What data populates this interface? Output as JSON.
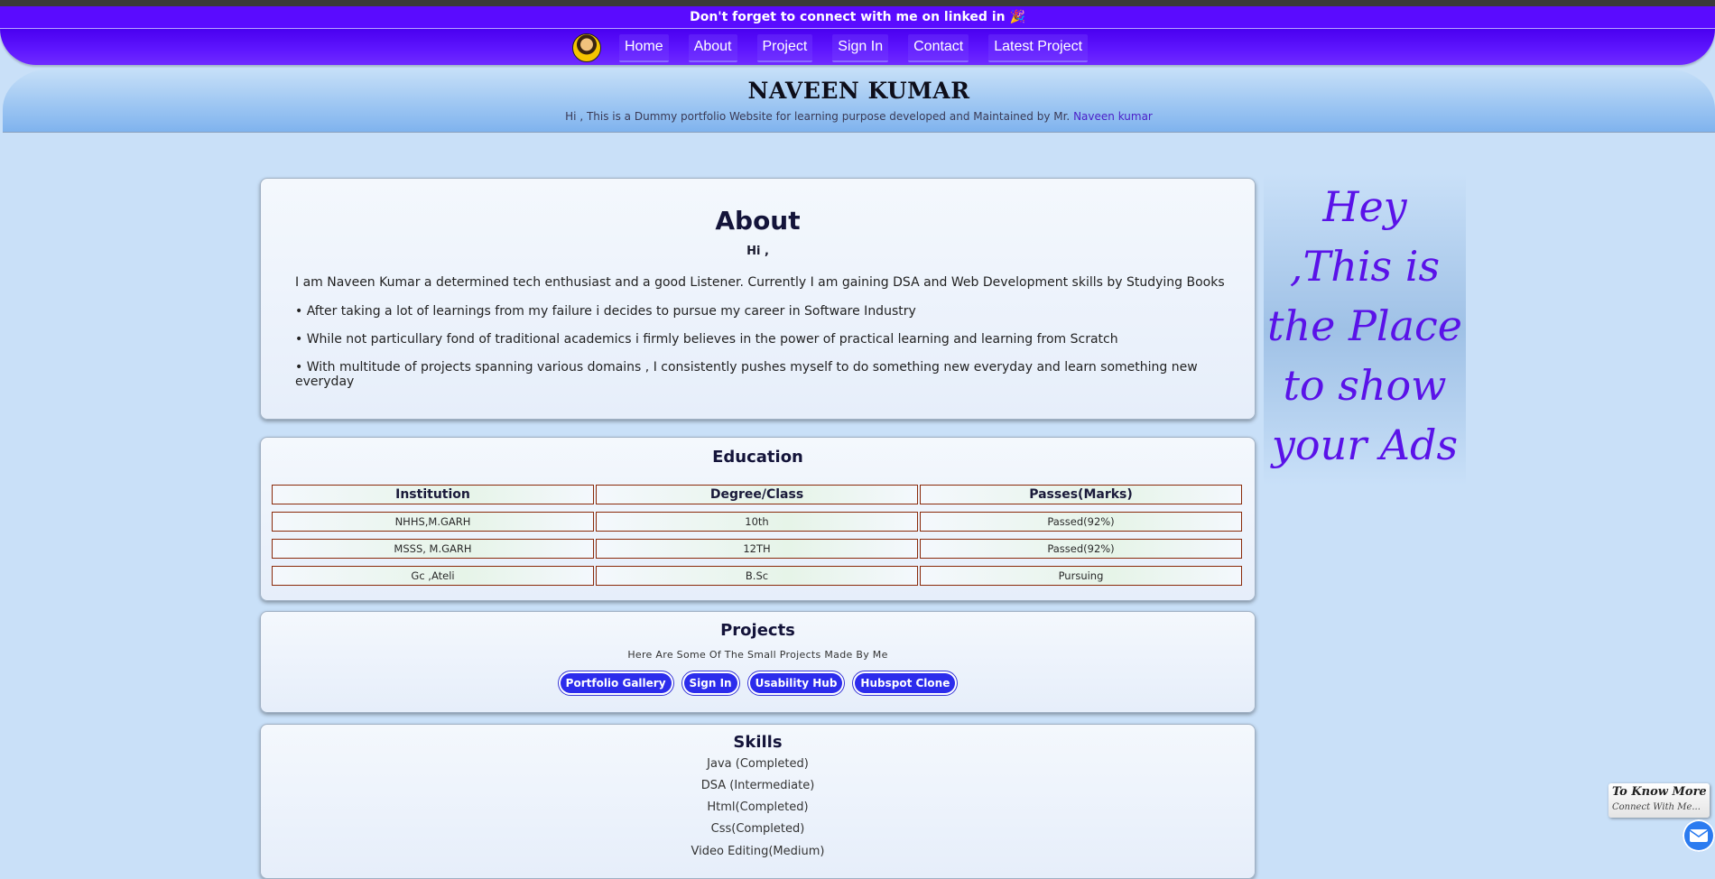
{
  "banner": {
    "text": "Don't forget to connect with me on linked in",
    "emoji": "🎉"
  },
  "nav": {
    "items": [
      {
        "label": "Home"
      },
      {
        "label": "About"
      },
      {
        "label": "Project"
      },
      {
        "label": "Sign In"
      },
      {
        "label": "Contact"
      },
      {
        "label": "Latest Project"
      }
    ]
  },
  "header": {
    "title": "NAVEEN KUMAR",
    "subtitle_prefix": "Hi , This is a Dummy portfolio Website for learning purpose developed and Maintained by Mr.",
    "subtitle_name": "Naveen kumar"
  },
  "about": {
    "title": "About",
    "greeting": "Hi ,",
    "paragraphs": [
      "I am Naveen Kumar a determined tech enthusiast and a good Listener. Currently I am gaining DSA and Web Development skills by Studying Books",
      "• After taking a lot of learnings from my failure i decides to pursue my career in Software Industry",
      "• While not particullary fond of traditional academics i firmly believes in the power of practical learning and learning from Scratch",
      "• With multitude of projects spanning various domains , I consistently pushes myself to do something new everyday and learn something new everyday"
    ]
  },
  "education": {
    "title": "Education",
    "headers": [
      "Institution",
      "Degree/Class",
      "Passes(Marks)"
    ],
    "rows": [
      [
        "NHHS,M.GARH",
        "10th",
        "Passed(92%)"
      ],
      [
        "MSSS, M.GARH",
        "12TH",
        "Passed(92%)"
      ],
      [
        "Gc ,Ateli",
        "B.Sc",
        "Pursuing"
      ]
    ]
  },
  "projects": {
    "title": "Projects",
    "subtitle": "Here Are Some Of The Small Projects Made By Me",
    "buttons": [
      "Portfolio Gallery",
      "Sign In",
      "Usability Hub",
      "Hubspot Clone"
    ]
  },
  "skills": {
    "title": "Skills",
    "items": [
      "Java (Completed)",
      "DSA (Intermediate)",
      "Html(Completed)",
      "Css(Completed)",
      "Video Editing(Medium)"
    ]
  },
  "ad": {
    "lines": [
      "Hey",
      ",This is",
      "the Place",
      "to show",
      "your Ads"
    ]
  },
  "contact_widget": {
    "title": "To Know More",
    "subtitle": "Connect With Me..."
  },
  "colors": {
    "banner": "#5a0bff",
    "nav": "#5f17ff",
    "page_bg": "#c9e0f8",
    "ad_text": "#5a12e8",
    "project_button": "#2c2cec",
    "table_border": "#8a2a0a"
  },
  "icons": {
    "avatar": "avatar",
    "mail": "mail-icon",
    "banner_emoji": "party-popper-icon"
  }
}
